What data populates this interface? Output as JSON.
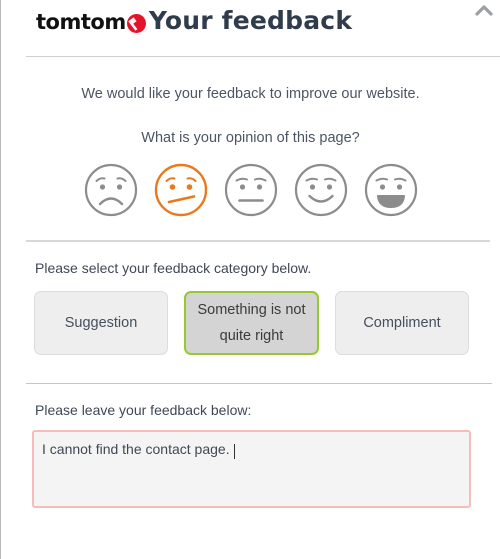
{
  "header": {
    "logo_text": "tomtom",
    "logo_icon": "tomtom-globe-icon",
    "title": "Your feedback",
    "collapse_icon": "chevron-up-icon"
  },
  "intro": {
    "line1": "We would like your feedback to improve our website.",
    "question": "What is your opinion of this page?"
  },
  "rating": {
    "selected_index": 1,
    "selected_color": "#e8791e",
    "unselected_color": "#8c8c8c",
    "faces": [
      {
        "name": "face-very-unhappy",
        "mood": "very-unhappy",
        "selected": false
      },
      {
        "name": "face-unhappy",
        "mood": "unhappy",
        "selected": true
      },
      {
        "name": "face-neutral",
        "mood": "neutral",
        "selected": false
      },
      {
        "name": "face-happy",
        "mood": "happy",
        "selected": false
      },
      {
        "name": "face-very-happy",
        "mood": "very-happy",
        "selected": false
      }
    ]
  },
  "category": {
    "label": "Please select your feedback category below.",
    "selected_index": 1,
    "selected_border_color": "#96c930",
    "buttons": [
      {
        "label": "Suggestion",
        "selected": false
      },
      {
        "label": "Something is not quite right",
        "selected": true
      },
      {
        "label": "Compliment",
        "selected": false
      }
    ]
  },
  "feedback": {
    "label": "Please leave your feedback below:",
    "value": "I cannot find the contact page.",
    "placeholder": "",
    "border_color": "#f6bcbc"
  }
}
